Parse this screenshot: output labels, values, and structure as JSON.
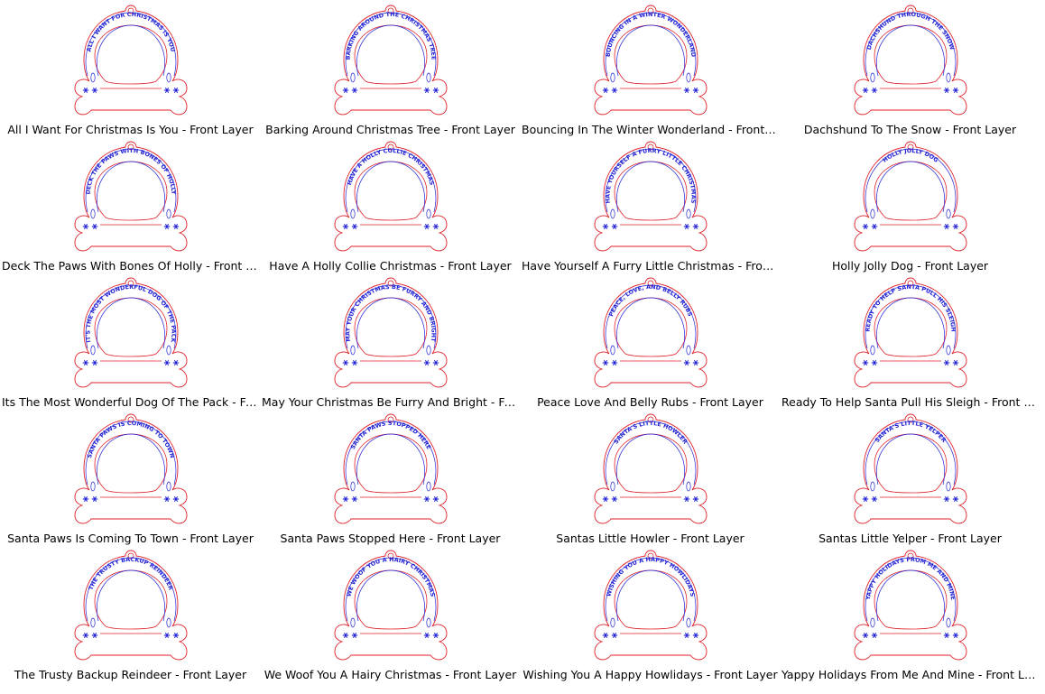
{
  "colors": {
    "cut_line": "#e0202a",
    "engrave": "#2424d6",
    "label_text": "#000000",
    "background": "#ffffff"
  },
  "files": [
    {
      "label": "All I Want For Christmas Is You - Front Layer",
      "arc_text": "ALL I WANT FOR CHRISTMAS IS YOU"
    },
    {
      "label": "Barking Around Christmas Tree - Front Layer",
      "arc_text": "BARKING AROUND THE CHRISTMAS TREE"
    },
    {
      "label": "Bouncing In The Winter Wonderland - Front La...",
      "arc_text": "BOUNCING IN A WINTER WONDERLAND"
    },
    {
      "label": "Dachshund To The Snow - Front Layer",
      "arc_text": "DACHSHUND THROUGH THE SNOW"
    },
    {
      "label": "Deck The Paws With Bones Of Holly - Front Layer",
      "arc_text": "DECK THE PAWS WITH BONES OF HOLLY"
    },
    {
      "label": "Have A Holly Collie Christmas - Front Layer",
      "arc_text": "HAVE A HOLLY COLLIE CHRISTMAS"
    },
    {
      "label": "Have Yourself A Furry Little Christmas - Front L...",
      "arc_text": "HAVE YOURSELF A FURRY LITTLE CHRISTMAS"
    },
    {
      "label": "Holly Jolly Dog - Front Layer",
      "arc_text": "HOLLY JOLLY DOG"
    },
    {
      "label": "Its The Most Wonderful Dog Of The Pack - Fro...",
      "arc_text": "IT'S THE MOST WONDERFUL DOG OF THE PACK"
    },
    {
      "label": "May Your Christmas Be Furry And Bright - Fron...",
      "arc_text": "MAY YOUR CHRISTMAS BE FURRY AND BRIGHT"
    },
    {
      "label": "Peace Love And Belly Rubs - Front Layer",
      "arc_text": "PEACE, LOVE, AND BELLY RUBS"
    },
    {
      "label": "Ready To Help Santa Pull His Sleigh - Front Layer",
      "arc_text": "READY TO HELP SANTA PULL HIS SLEIGH"
    },
    {
      "label": "Santa Paws Is Coming To Town - Front Layer",
      "arc_text": "SANTA PAWS IS COMING TO TOWN"
    },
    {
      "label": "Santa Paws Stopped Here - Front Layer",
      "arc_text": "SANTA PAWS STOPPED HERE"
    },
    {
      "label": "Santas Little Howler - Front Layer",
      "arc_text": "SANTA'S LITTLE HOWLER"
    },
    {
      "label": "Santas Little Yelper - Front Layer",
      "arc_text": "SANTA'S LITTLE YELPER"
    },
    {
      "label": "The Trusty Backup Reindeer - Front Layer",
      "arc_text": "THE TRUSTY BACKUP REINDEER"
    },
    {
      "label": "We Woof You A Hairy Christmas - Front Layer",
      "arc_text": "WE WOOF YOU A HAIRY CHRISTMAS"
    },
    {
      "label": "Wishing You A Happy Howlidays - Front Layer",
      "arc_text": "WISHING YOU A HAPPY HOWLIDAYS"
    },
    {
      "label": "Yappy Holidays From Me And Mine - Front Layer",
      "arc_text": "YAPPY HOLIDAYS FROM ME AND MINE"
    }
  ]
}
